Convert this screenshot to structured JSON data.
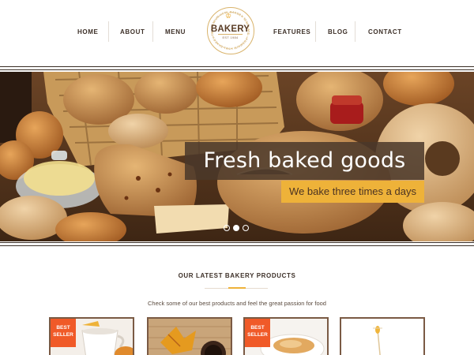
{
  "header": {
    "nav_left": [
      "HOME",
      "ABOUT",
      "MENU"
    ],
    "nav_right": [
      "FEATURES",
      "BLOG",
      "CONTACT"
    ],
    "logo": {
      "word": "BAKERY",
      "established": "EST 1984",
      "ring_text": "PREMIUM HTML BAKERY TEMPLATE · PREMIUM HTML BAKERY TEMPLATE ·"
    }
  },
  "hero": {
    "headline": "Fresh baked goods",
    "subline": "We bake three times a days",
    "slides": {
      "count": 3,
      "active": 2
    }
  },
  "products": {
    "title": "OUR LATEST BAKERY PRODUCTS",
    "description": "Check some of our best products and feel the great passion for food",
    "cards": [
      {
        "badge_line1": "BEST",
        "badge_line2": "SELLER",
        "image_icon": "coffee-cup-croissant-icon"
      },
      {
        "badge_line1": "",
        "badge_line2": "",
        "image_icon": "autumn-leaves-coffee-icon"
      },
      {
        "badge_line1": "BEST",
        "badge_line2": "SELLER",
        "image_icon": "pastry-plate-icon"
      },
      {
        "badge_line1": "",
        "badge_line2": "",
        "image_icon": "honey-dipper-icon"
      }
    ]
  },
  "colors": {
    "accent": "#eeb239",
    "badge": "#f05a28",
    "text_dark": "#3d3028",
    "card_border": "#7a5a44"
  }
}
